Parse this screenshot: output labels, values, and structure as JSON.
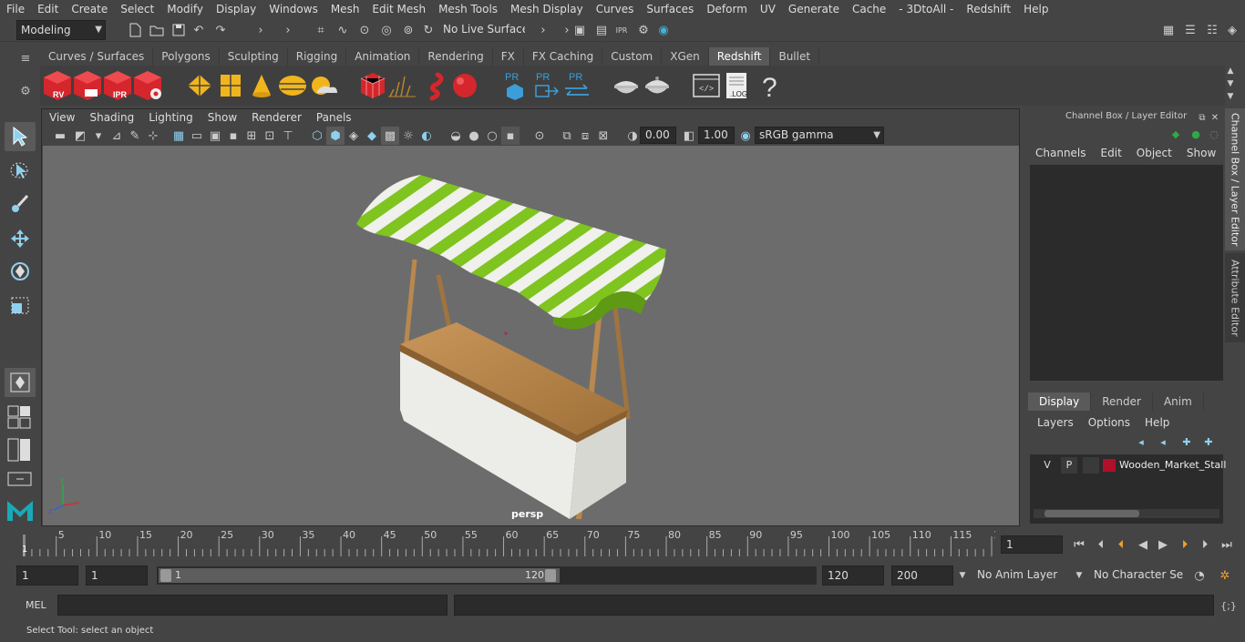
{
  "menubar": {
    "items": [
      "File",
      "Edit",
      "Create",
      "Select",
      "Modify",
      "Display",
      "Windows",
      "Mesh",
      "Edit Mesh",
      "Mesh Tools",
      "Mesh Display",
      "Curves",
      "Surfaces",
      "Deform",
      "UV",
      "Generate",
      "Cache",
      "- 3DtoAll -",
      "Redshift",
      "Help"
    ]
  },
  "statusline": {
    "mode_value": "Modeling",
    "live_surface": "No Live Surface"
  },
  "shelf": {
    "tabs": [
      "Curves / Surfaces",
      "Polygons",
      "Sculpting",
      "Rigging",
      "Animation",
      "Rendering",
      "FX",
      "FX Caching",
      "Custom",
      "XGen",
      "Redshift",
      "Bullet"
    ],
    "active_tab": "Redshift",
    "rs_labels": {
      "rv": "RV",
      "ipr": "IPR",
      "pr": "PR",
      "log": ".LOG",
      "help": "?"
    }
  },
  "viewport": {
    "menus": [
      "View",
      "Shading",
      "Lighting",
      "Show",
      "Renderer",
      "Panels"
    ],
    "exposure": "0.00",
    "gamma": "1.00",
    "colorspace": "sRGB gamma",
    "camera_label": "persp",
    "colors": {
      "bg": "#6c6c6c",
      "stripe_green": "#7fc41f",
      "stripe_white": "#f0f0ec",
      "wood": "#b8884e",
      "cloth": "#ecece8"
    }
  },
  "channelbox": {
    "title": "Channel Box / Layer Editor",
    "menus": [
      "Channels",
      "Edit",
      "Object",
      "Show"
    ],
    "layer_tabs": [
      "Display",
      "Render",
      "Anim"
    ],
    "active_layer_tab": "Display",
    "layer_menus": [
      "Layers",
      "Options",
      "Help"
    ],
    "layer": {
      "v": "V",
      "p": "P",
      "name": "Wooden_Market_Stall",
      "color": "#b0102a"
    }
  },
  "side_tabs": {
    "channel_box": "Channel Box / Layer Editor",
    "attribute_editor": "Attribute Editor"
  },
  "timeline": {
    "ticks": [
      "5",
      "10",
      "15",
      "20",
      "25",
      "30",
      "35",
      "40",
      "45",
      "50",
      "55",
      "60",
      "65",
      "70",
      "75",
      "80",
      "85",
      "90",
      "95",
      "100",
      "105",
      "110",
      "115",
      "12"
    ],
    "current_frame_marker": "1",
    "current_frame": "1"
  },
  "range": {
    "start": "1",
    "playback_start": "1",
    "slider_start": "1",
    "slider_end": "120",
    "playback_end": "120",
    "end": "200",
    "anim_layer": "No Anim Layer",
    "character_set": "No Character Set"
  },
  "cmdline": {
    "label": "MEL"
  },
  "helpline": {
    "text": "Select Tool: select an object"
  }
}
